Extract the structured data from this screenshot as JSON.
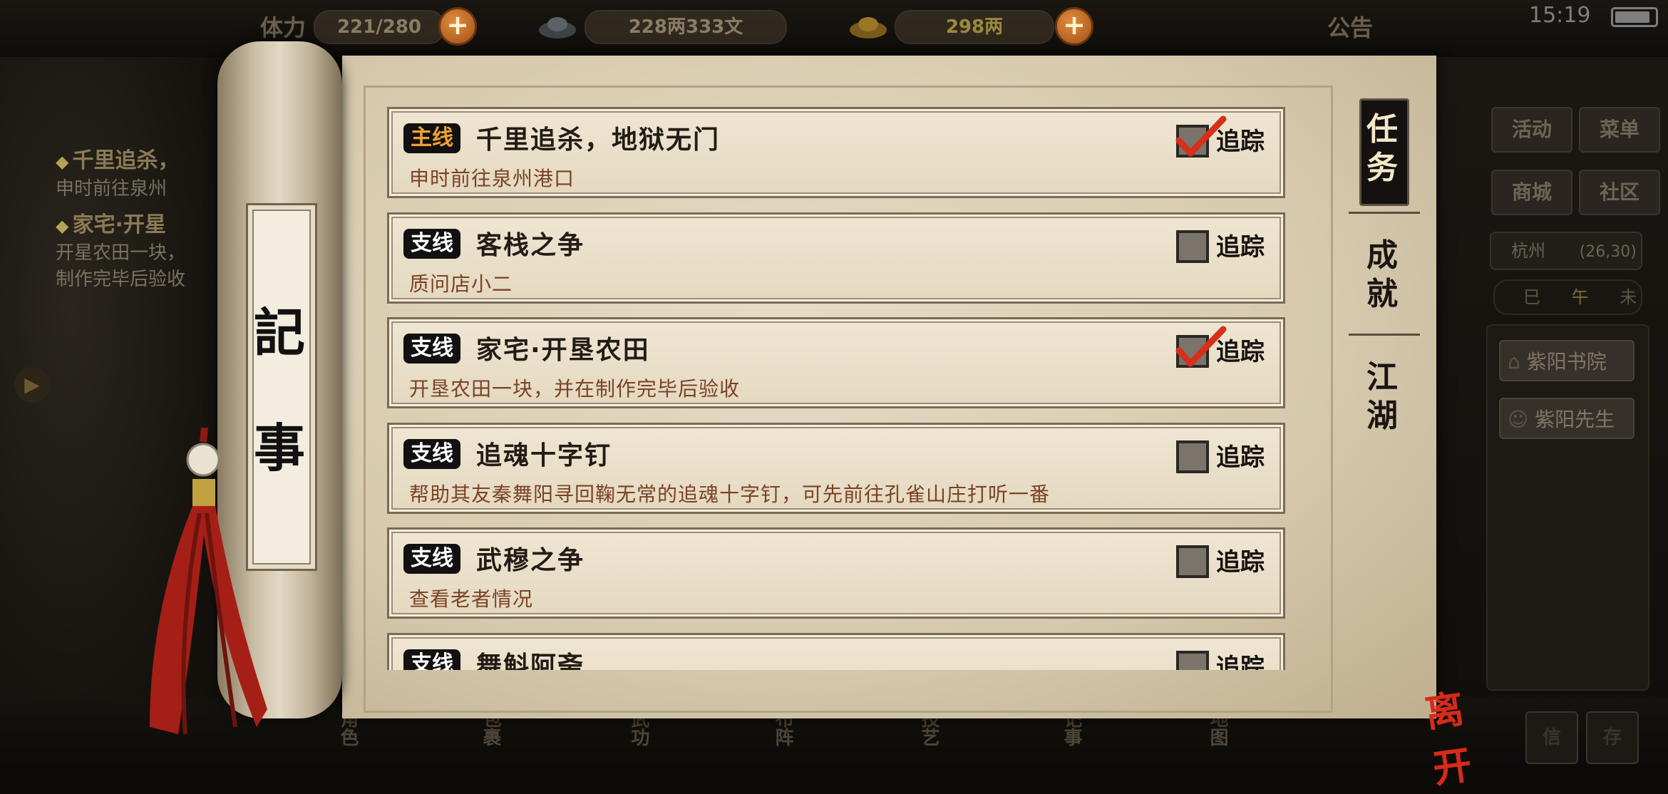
{
  "status_bar": {
    "time": "15:19"
  },
  "top_bar": {
    "stamina_label": "体力",
    "stamina_value": "221/280",
    "money_value": "228两333文",
    "gold_value": "298两",
    "announcement_label": "公告"
  },
  "left_tracker": [
    {
      "title": "千里追杀，",
      "desc": "申时前往泉州"
    },
    {
      "title": "家宅·开星",
      "desc": "开星农田一块，",
      "desc2": "制作完毕后验收"
    }
  ],
  "right_menu": {
    "buttons": [
      "活动",
      "菜单",
      "商城",
      "社区"
    ],
    "location": "杭州",
    "coords": "(26,30)",
    "time_dial": [
      "巳",
      "午",
      "未"
    ],
    "npc_buttons": [
      "紫阳书院",
      "紫阳先生"
    ],
    "bottom_right_labels": [
      "信",
      "存"
    ]
  },
  "bottom_bar": {
    "labels": [
      "角色",
      "包裹",
      "武功",
      "布阵",
      "技艺",
      "记事",
      "地图"
    ]
  },
  "scroll": {
    "label_chars": [
      "記",
      "事"
    ]
  },
  "tabs": {
    "items": [
      "任务",
      "成就",
      "江湖"
    ],
    "active": "任务"
  },
  "quests": [
    {
      "type": "主线",
      "title": "千里追杀，地狱无门",
      "desc": "申时前往泉州港口",
      "tracked": true,
      "track_label": "追踪"
    },
    {
      "type": "支线",
      "title": "客栈之争",
      "desc": "质问店小二",
      "tracked": false,
      "track_label": "追踪"
    },
    {
      "type": "支线",
      "title": "家宅·开垦农田",
      "desc": "开垦农田一块，并在制作完毕后验收",
      "tracked": true,
      "track_label": "追踪"
    },
    {
      "type": "支线",
      "title": "追魂十字钉",
      "desc": "帮助其友秦舞阳寻回鞠无常的追魂十字钉，可先前往孔雀山庄打听一番",
      "tracked": false,
      "track_label": "追踪"
    },
    {
      "type": "支线",
      "title": "武穆之争",
      "desc": "查看老者情况",
      "tracked": false,
      "track_label": "追踪"
    },
    {
      "type": "支线",
      "title": "舞斛阿斋",
      "desc": "",
      "tracked": false,
      "track_label": "追踪"
    }
  ],
  "leave_label": "离开",
  "colors": {
    "main_badge_text": "#f0a232",
    "desc_text": "#7a4226",
    "check_red": "#d6301c",
    "leave_red": "#d62a1a"
  }
}
